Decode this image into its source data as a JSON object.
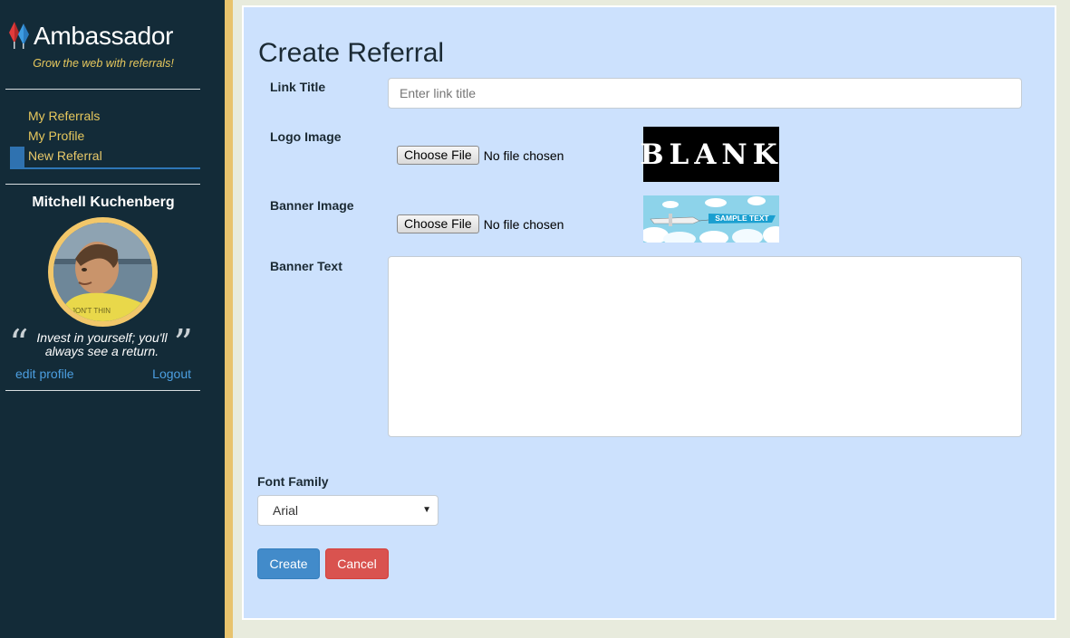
{
  "brand": {
    "name": "Ambassador",
    "tagline": "Grow the web with referrals!"
  },
  "nav": {
    "items": [
      {
        "label": "My Referrals",
        "active": false
      },
      {
        "label": "My Profile",
        "active": false
      },
      {
        "label": "New Referral",
        "active": true
      }
    ]
  },
  "user": {
    "name": "Mitchell Kuchenberg",
    "quote": "Invest in yourself; you'll always see a return.",
    "edit_label": "edit profile",
    "logout_label": "Logout"
  },
  "form": {
    "title": "Create Referral",
    "link_title": {
      "label": "Link Title",
      "placeholder": "Enter link title",
      "value": ""
    },
    "logo_image": {
      "label": "Logo Image",
      "button": "Choose File",
      "status": "No file chosen",
      "preview_text": "BLANK"
    },
    "banner_image": {
      "label": "Banner Image",
      "button": "Choose File",
      "status": "No file chosen",
      "preview_text": "SAMPLE TEXT"
    },
    "banner_text": {
      "label": "Banner Text",
      "value": ""
    },
    "font_family": {
      "label": "Font Family",
      "selected": "Arial"
    },
    "create_label": "Create",
    "cancel_label": "Cancel"
  },
  "colors": {
    "sidebar_bg": "#132b38",
    "accent_gold": "#e7c85d",
    "panel_bg": "#cce1fd",
    "primary": "#428bca",
    "danger": "#d9534f"
  }
}
